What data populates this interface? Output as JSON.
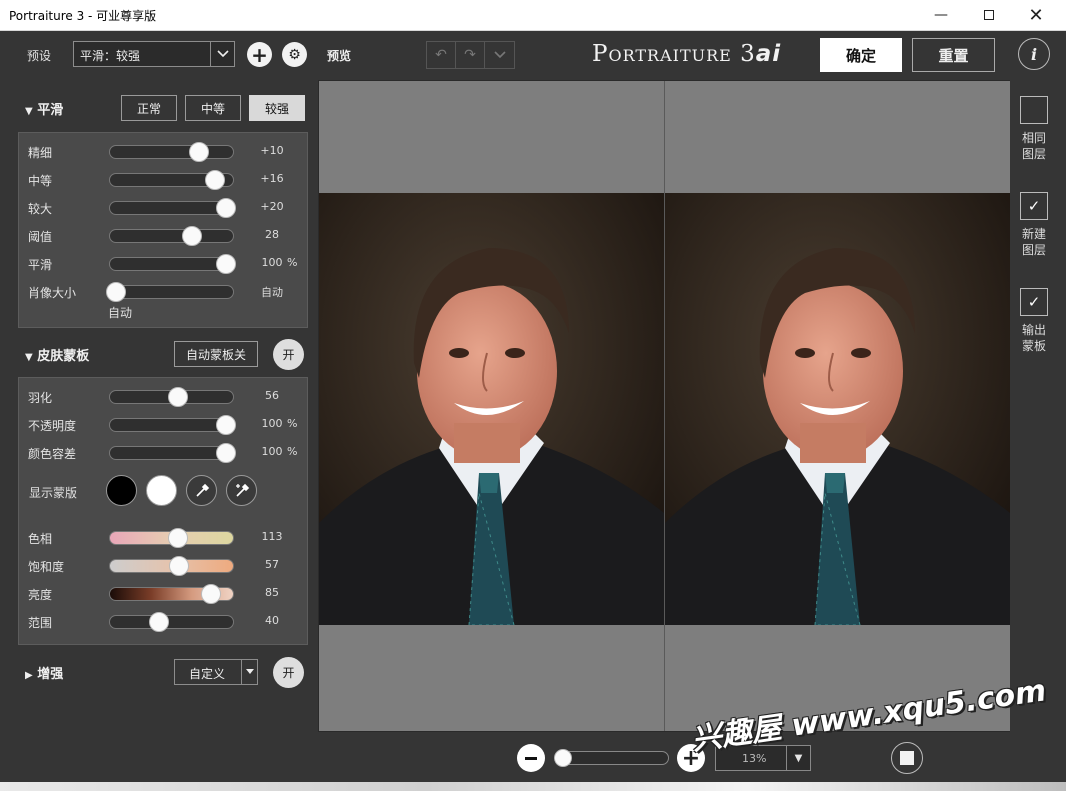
{
  "window": {
    "title": "Portraiture 3 - 可业尊享版"
  },
  "presets": {
    "label": "预设",
    "value": "平滑：较强"
  },
  "smoothing": {
    "title": "平滑",
    "modes": [
      "正常",
      "中等",
      "较强"
    ],
    "active_mode": "较强",
    "sliders": [
      {
        "name": "精细",
        "value": "+10",
        "fraction": 0.72,
        "unit": ""
      },
      {
        "name": "中等",
        "value": "+16",
        "fraction": 0.85,
        "unit": ""
      },
      {
        "name": "较大",
        "value": "+20",
        "fraction": 0.94,
        "unit": ""
      },
      {
        "name": "阈值",
        "value": "28",
        "fraction": 0.67,
        "unit": ""
      },
      {
        "name": "平滑",
        "value": "100",
        "fraction": 0.94,
        "unit": "%"
      },
      {
        "name": "肖像大小",
        "value": "自动",
        "fraction": 0.05,
        "unit": ""
      }
    ],
    "portrait_size_sub": "自动"
  },
  "skin_mask": {
    "title": "皮肤蒙板",
    "auto_mask_label": "自动蒙板关",
    "toggle_label": "开",
    "sliders": [
      {
        "name": "羽化",
        "value": "56",
        "fraction": 0.55,
        "unit": ""
      },
      {
        "name": "不透明度",
        "value": "100",
        "fraction": 0.94,
        "unit": "%"
      },
      {
        "name": "颜色容差",
        "value": "100",
        "fraction": 0.94,
        "unit": "%"
      }
    ],
    "show_mask_label": "显示蒙版",
    "color_sliders": [
      {
        "name": "色相",
        "value": "113",
        "fraction": 0.55,
        "track": "linear-gradient(90deg,#e9a7b9,#e6cdb1,#ddd7a0)"
      },
      {
        "name": "饱和度",
        "value": "57",
        "fraction": 0.56,
        "track": "linear-gradient(90deg,#cdcdcd,#e5c3ad,#eeaa7f)"
      },
      {
        "name": "亮度",
        "value": "85",
        "fraction": 0.82,
        "track": "linear-gradient(90deg,#1a0c08,#7a3d28,#d59b80,#f0d3c4)"
      },
      {
        "name": "范围",
        "value": "40",
        "fraction": 0.4,
        "track": "#2f2f2f"
      }
    ]
  },
  "enhance": {
    "title": "增强",
    "preset": "自定义",
    "toggle_label": "开"
  },
  "toolbar": {
    "preview_label": "预览",
    "brand": "Portraiture 3",
    "brand_suffix": "ai",
    "ok_label": "确定",
    "reset_label": "重置",
    "info_label": "i"
  },
  "output_options": [
    {
      "label_l1": "相同",
      "label_l2": "图层",
      "checked": false
    },
    {
      "label_l1": "新建",
      "label_l2": "图层",
      "checked": true
    },
    {
      "label_l1": "输出",
      "label_l2": "蒙板",
      "checked": true
    }
  ],
  "zoom": {
    "value": "13%",
    "fraction": 0.06
  },
  "watermark": "兴趣屋 www.xqu5.com",
  "colors": {
    "panel": "#4a4a4a",
    "bg": "#353535",
    "accent": "#ffffff"
  }
}
